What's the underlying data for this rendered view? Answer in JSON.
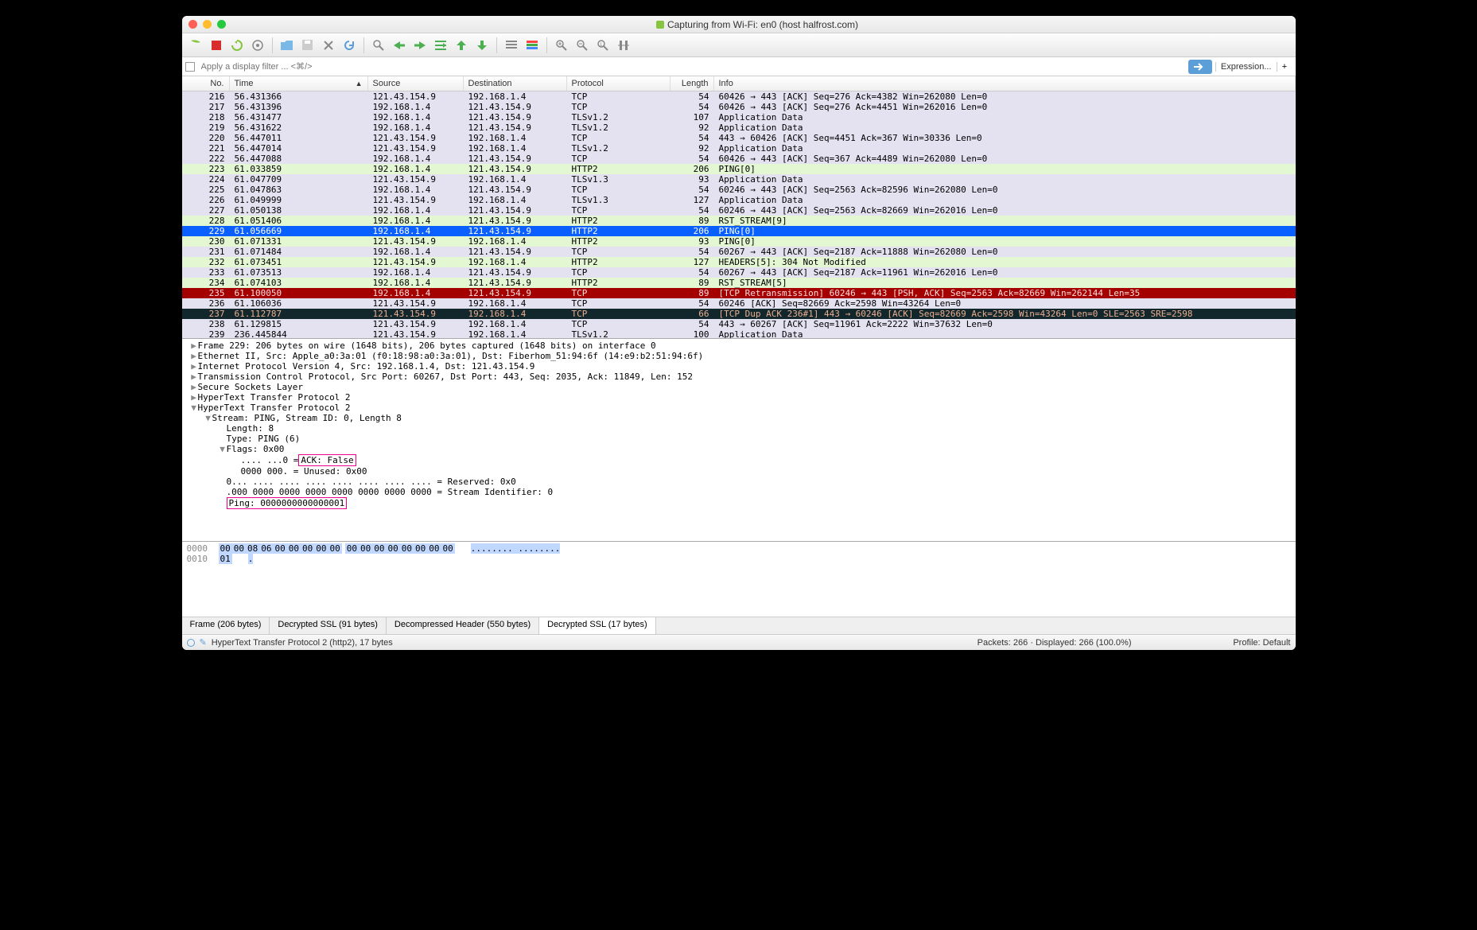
{
  "window": {
    "title": "Capturing from Wi-Fi: en0 (host halfrost.com)"
  },
  "filter": {
    "placeholder": "Apply a display filter ... <⌘/>",
    "expression_label": "Expression...",
    "plus": "+"
  },
  "columns": {
    "no": "No.",
    "time": "Time",
    "source": "Source",
    "destination": "Destination",
    "protocol": "Protocol",
    "length": "Length",
    "info": "Info"
  },
  "packets": [
    {
      "no": "216",
      "time": "56.431366",
      "src": "121.43.154.9",
      "dst": "192.168.1.4",
      "proto": "TCP",
      "len": "54",
      "info": "60426 → 443 [ACK] Seq=276 Ack=4382 Win=262080 Len=0",
      "cls": "lav"
    },
    {
      "no": "217",
      "time": "56.431396",
      "src": "192.168.1.4",
      "dst": "121.43.154.9",
      "proto": "TCP",
      "len": "54",
      "info": "60426 → 443 [ACK] Seq=276 Ack=4451 Win=262016 Len=0",
      "cls": "lav"
    },
    {
      "no": "218",
      "time": "56.431477",
      "src": "192.168.1.4",
      "dst": "121.43.154.9",
      "proto": "TLSv1.2",
      "len": "107",
      "info": "Application Data",
      "cls": "lav"
    },
    {
      "no": "219",
      "time": "56.431622",
      "src": "192.168.1.4",
      "dst": "121.43.154.9",
      "proto": "TLSv1.2",
      "len": "92",
      "info": "Application Data",
      "cls": "lav"
    },
    {
      "no": "220",
      "time": "56.447011",
      "src": "121.43.154.9",
      "dst": "192.168.1.4",
      "proto": "TCP",
      "len": "54",
      "info": "443 → 60426 [ACK] Seq=4451 Ack=367 Win=30336 Len=0",
      "cls": "lav"
    },
    {
      "no": "221",
      "time": "56.447014",
      "src": "121.43.154.9",
      "dst": "192.168.1.4",
      "proto": "TLSv1.2",
      "len": "92",
      "info": "Application Data",
      "cls": "lav"
    },
    {
      "no": "222",
      "time": "56.447088",
      "src": "192.168.1.4",
      "dst": "121.43.154.9",
      "proto": "TCP",
      "len": "54",
      "info": "60426 → 443 [ACK] Seq=367 Ack=4489 Win=262080 Len=0",
      "cls": "lav"
    },
    {
      "no": "223",
      "time": "61.033859",
      "src": "192.168.1.4",
      "dst": "121.43.154.9",
      "proto": "HTTP2",
      "len": "206",
      "info": "PING[0]",
      "cls": "grn"
    },
    {
      "no": "224",
      "time": "61.047709",
      "src": "121.43.154.9",
      "dst": "192.168.1.4",
      "proto": "TLSv1.3",
      "len": "93",
      "info": "Application Data",
      "cls": "lav"
    },
    {
      "no": "225",
      "time": "61.047863",
      "src": "192.168.1.4",
      "dst": "121.43.154.9",
      "proto": "TCP",
      "len": "54",
      "info": "60246 → 443 [ACK] Seq=2563 Ack=82596 Win=262080 Len=0",
      "cls": "lav"
    },
    {
      "no": "226",
      "time": "61.049999",
      "src": "121.43.154.9",
      "dst": "192.168.1.4",
      "proto": "TLSv1.3",
      "len": "127",
      "info": "Application Data",
      "cls": "lav"
    },
    {
      "no": "227",
      "time": "61.050138",
      "src": "192.168.1.4",
      "dst": "121.43.154.9",
      "proto": "TCP",
      "len": "54",
      "info": "60246 → 443 [ACK] Seq=2563 Ack=82669 Win=262016 Len=0",
      "cls": "lav"
    },
    {
      "no": "228",
      "time": "61.051406",
      "src": "192.168.1.4",
      "dst": "121.43.154.9",
      "proto": "HTTP2",
      "len": "89",
      "info": "RST_STREAM[9]",
      "cls": "grn"
    },
    {
      "no": "229",
      "time": "61.056669",
      "src": "192.168.1.4",
      "dst": "121.43.154.9",
      "proto": "HTTP2",
      "len": "206",
      "info": "PING[0]",
      "cls": "sel"
    },
    {
      "no": "230",
      "time": "61.071331",
      "src": "121.43.154.9",
      "dst": "192.168.1.4",
      "proto": "HTTP2",
      "len": "93",
      "info": "PING[0]",
      "cls": "grn"
    },
    {
      "no": "231",
      "time": "61.071484",
      "src": "192.168.1.4",
      "dst": "121.43.154.9",
      "proto": "TCP",
      "len": "54",
      "info": "60267 → 443 [ACK] Seq=2187 Ack=11888 Win=262080 Len=0",
      "cls": "lav"
    },
    {
      "no": "232",
      "time": "61.073451",
      "src": "121.43.154.9",
      "dst": "192.168.1.4",
      "proto": "HTTP2",
      "len": "127",
      "info": "HEADERS[5]: 304 Not Modified",
      "cls": "grn"
    },
    {
      "no": "233",
      "time": "61.073513",
      "src": "192.168.1.4",
      "dst": "121.43.154.9",
      "proto": "TCP",
      "len": "54",
      "info": "60267 → 443 [ACK] Seq=2187 Ack=11961 Win=262016 Len=0",
      "cls": "lav"
    },
    {
      "no": "234",
      "time": "61.074103",
      "src": "192.168.1.4",
      "dst": "121.43.154.9",
      "proto": "HTTP2",
      "len": "89",
      "info": "RST_STREAM[5]",
      "cls": "grn"
    },
    {
      "no": "235",
      "time": "61.100050",
      "src": "192.168.1.4",
      "dst": "121.43.154.9",
      "proto": "TCP",
      "len": "89",
      "info": "[TCP Retransmission] 60246 → 443 [PSH, ACK] Seq=2563 Ack=82669 Win=262144 Len=35",
      "cls": "red-r"
    },
    {
      "no": "236",
      "time": "61.106036",
      "src": "121.43.154.9",
      "dst": "192.168.1.4",
      "proto": "TCP",
      "len": "54",
      "info": "60246 [ACK] Seq=82669 Ack=2598 Win=43264 Len=0",
      "cls": "lav"
    },
    {
      "no": "237",
      "time": "61.112787",
      "src": "121.43.154.9",
      "dst": "192.168.1.4",
      "proto": "TCP",
      "len": "66",
      "info": "[TCP Dup ACK 236#1] 443 → 60246 [ACK] Seq=82669 Ack=2598 Win=43264 Len=0 SLE=2563 SRE=2598",
      "cls": "dark-r"
    },
    {
      "no": "238",
      "time": "61.129815",
      "src": "121.43.154.9",
      "dst": "192.168.1.4",
      "proto": "TCP",
      "len": "54",
      "info": "443 → 60267 [ACK] Seq=11961 Ack=2222 Win=37632 Len=0",
      "cls": "lav"
    },
    {
      "no": "239",
      "time": "236.445844",
      "src": "121.43.154.9",
      "dst": "192.168.1.4",
      "proto": "TLSv1.2",
      "len": "100",
      "info": "Application Data",
      "cls": "lav"
    }
  ],
  "details": [
    {
      "ind": 0,
      "tgl": "▶",
      "txt": "Frame 229: 206 bytes on wire (1648 bits), 206 bytes captured (1648 bits) on interface 0"
    },
    {
      "ind": 0,
      "tgl": "▶",
      "txt": "Ethernet II, Src: Apple_a0:3a:01 (f0:18:98:a0:3a:01), Dst: Fiberhom_51:94:6f (14:e9:b2:51:94:6f)"
    },
    {
      "ind": 0,
      "tgl": "▶",
      "txt": "Internet Protocol Version 4, Src: 192.168.1.4, Dst: 121.43.154.9"
    },
    {
      "ind": 0,
      "tgl": "▶",
      "txt": "Transmission Control Protocol, Src Port: 60267, Dst Port: 443, Seq: 2035, Ack: 11849, Len: 152"
    },
    {
      "ind": 0,
      "tgl": "▶",
      "txt": "Secure Sockets Layer"
    },
    {
      "ind": 0,
      "tgl": "▶",
      "txt": "HyperText Transfer Protocol 2"
    },
    {
      "ind": 0,
      "tgl": "▼",
      "txt": "HyperText Transfer Protocol 2"
    },
    {
      "ind": 1,
      "tgl": "▼",
      "txt": "Stream: PING, Stream ID: 0, Length 8"
    },
    {
      "ind": 2,
      "tgl": "",
      "txt": "Length: 8"
    },
    {
      "ind": 2,
      "tgl": "",
      "txt": "Type: PING (6)"
    },
    {
      "ind": 2,
      "tgl": "▼",
      "txt": "Flags: 0x00"
    },
    {
      "ind": 3,
      "tgl": "",
      "txt": ".... ...0 = ",
      "hl": "ACK: False"
    },
    {
      "ind": 3,
      "tgl": "",
      "txt": "0000 000. = Unused: 0x00"
    },
    {
      "ind": 2,
      "tgl": "",
      "txt": "0... .... .... .... .... .... .... .... = Reserved: 0x0"
    },
    {
      "ind": 2,
      "tgl": "",
      "txt": ".000 0000 0000 0000 0000 0000 0000 0000 = Stream Identifier: 0"
    },
    {
      "ind": 2,
      "tgl": "",
      "txt": "",
      "hl": "Ping: 0000000000000001"
    }
  ],
  "hex": {
    "rows": [
      {
        "off": "0000",
        "bytes": [
          "00",
          "00",
          "08",
          "06",
          "00",
          "00",
          "00",
          "00",
          "00",
          "",
          "00",
          "00",
          "00",
          "00",
          "00",
          "00",
          "00",
          "00"
        ],
        "asciisel": "........  ........"
      },
      {
        "off": "0010",
        "bytes": [
          "01"
        ],
        "asciisel": "."
      }
    ]
  },
  "tabs": [
    {
      "label": "Frame (206 bytes)",
      "active": false
    },
    {
      "label": "Decrypted SSL (91 bytes)",
      "active": false
    },
    {
      "label": "Decompressed Header (550 bytes)",
      "active": false
    },
    {
      "label": "Decrypted SSL (17 bytes)",
      "active": true
    }
  ],
  "status": {
    "left": "HyperText Transfer Protocol 2 (http2), 17 bytes",
    "center": "Packets: 266 · Displayed: 266 (100.0%)",
    "right": "Profile: Default"
  }
}
